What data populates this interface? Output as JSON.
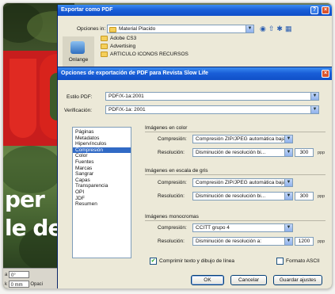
{
  "poster": {
    "text_lines": [
      "per",
      "le de"
    ],
    "field1_label": "a",
    "field1_value": "0°",
    "field2_label": "k",
    "field2_value": "0 mm",
    "field2_suffix": "Opaci"
  },
  "export_dialog": {
    "title": "Exportar como PDF",
    "lookin_label": "Opciones in:",
    "lookin_value": "Material Placido",
    "place_label": "Onlange",
    "files": [
      "Adobe CS3",
      "Advertising",
      "ARTICULO ICONOS RECURSOS"
    ]
  },
  "options_dialog": {
    "title": "Opciones de exportación de PDF para Revista Slow Life",
    "style_label": "Estilo PDF:",
    "style_value": "PDF/X-1a:2001",
    "verify_label": "Verificación:",
    "verify_value": "PDF/X-1a: 2001",
    "categories": [
      "Páginas",
      "Metadatos",
      "Hipervínculos",
      "Compresión",
      "Color",
      "Fuentes",
      "Marcas",
      "Sangrar",
      "Capas",
      "Transparencia",
      "OPI",
      "JDF",
      "Resumen"
    ],
    "selected_category": "Compresión",
    "color_images": {
      "title": "Imágenes en color",
      "compression_label": "Compresión:",
      "compression_value": "Compresión ZIP/JPEG automática baja",
      "resolution_label": "Resolución:",
      "resolution_value": "Disminución de resolución bi...",
      "dpi": "300",
      "unit": "ppp"
    },
    "gray_images": {
      "title": "Imágenes en escala de gris",
      "compression_label": "Compresión:",
      "compression_value": "Compresión ZIP/JPEG automática baja",
      "resolution_label": "Resolución:",
      "resolution_value": "Disminución de resolución bi...",
      "dpi": "300",
      "unit": "ppp"
    },
    "mono_images": {
      "title": "Imágenes monocromas",
      "compression_label": "Compresión:",
      "compression_value": "CCITT grupo 4",
      "resolution_label": "Resolución:",
      "resolution_value": "Disminución de resolución a:",
      "dpi": "1200",
      "unit": "ppp"
    },
    "compress_text_label": "Comprimir texto y dibujo de línea",
    "compress_text_checked": true,
    "ascii_label": "Formato ASCII",
    "ascii_checked": false,
    "buttons": {
      "ok": "OK",
      "cancel": "Cancelar",
      "save": "Guardar ajustes"
    }
  },
  "colors": {
    "titlebar": "#0f4fc8",
    "selection": "#316ac5",
    "close": "#d9532c",
    "dialog_bg": "#ece9d8"
  }
}
